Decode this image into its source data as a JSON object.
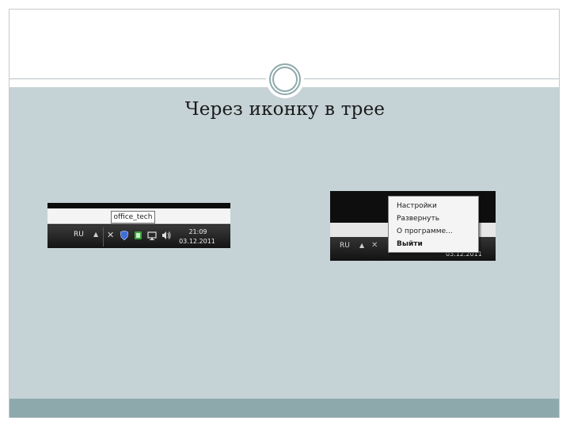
{
  "slide": {
    "title": "Через иконку в трее"
  },
  "colors": {
    "content_bg": "#c5d2d6",
    "footer_bg": "#8ea9ab",
    "ring": "#8ea9ab"
  },
  "screenshot1": {
    "tooltip": "office_tech",
    "language": "RU",
    "time": "21:09",
    "date": "03.12.2011",
    "icons": [
      "tools-icon",
      "shield-icon",
      "green-app-icon",
      "network-icon",
      "volume-icon"
    ]
  },
  "screenshot2": {
    "language": "RU",
    "date": "03.12.2011",
    "menu": {
      "items": [
        "Настройки",
        "Развернуть",
        "О программе...",
        "Выйти"
      ]
    }
  }
}
